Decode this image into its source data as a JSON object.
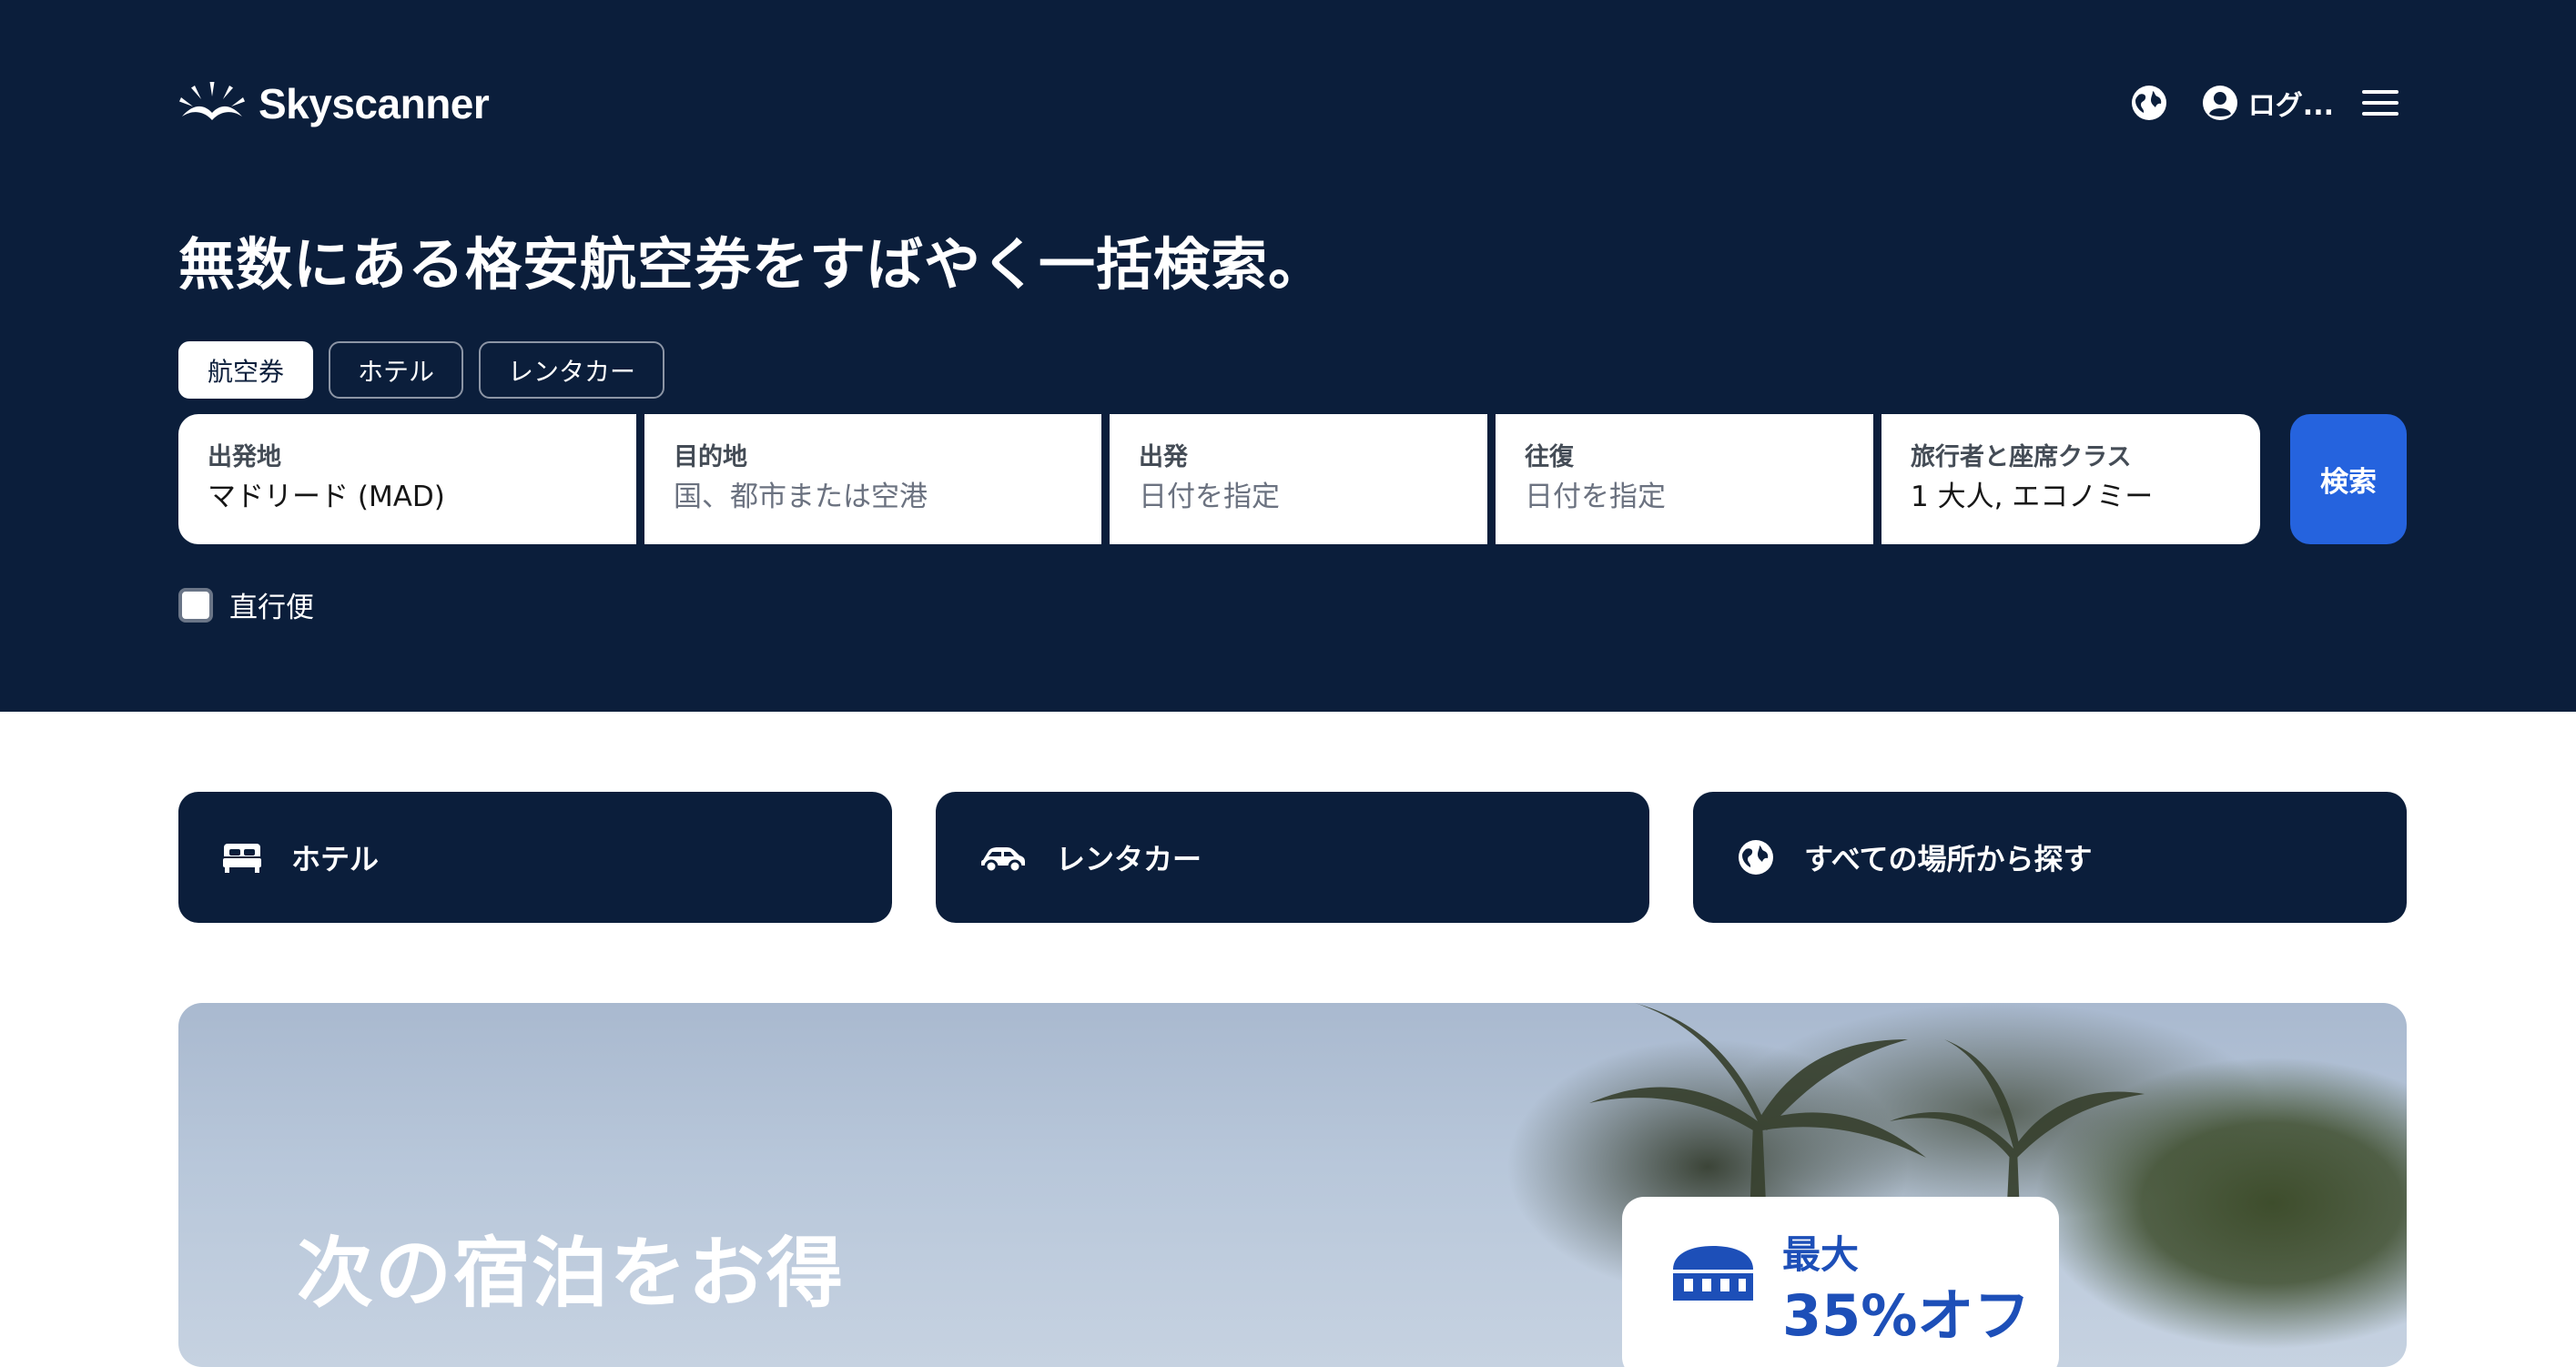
{
  "brand": {
    "name": "Skyscanner"
  },
  "header": {
    "login_label": "ログ..."
  },
  "hero": {
    "headline": "無数にある格安航空券をすばやく一括検索。",
    "tabs": [
      {
        "label": "航空券",
        "active": true
      },
      {
        "label": "ホテル",
        "active": false
      },
      {
        "label": "レンタカー",
        "active": false
      }
    ],
    "fields": {
      "origin": {
        "label": "出発地",
        "value": "マドリード (MAD)"
      },
      "destination": {
        "label": "目的地",
        "placeholder": "国、都市または空港"
      },
      "depart": {
        "label": "出発",
        "placeholder": "日付を指定"
      },
      "return": {
        "label": "往復",
        "placeholder": "日付を指定"
      },
      "travellers": {
        "label": "旅行者と座席クラス",
        "value": "1 大人, エコノミー"
      }
    },
    "search_label": "検索",
    "direct_label": "直行便",
    "direct_checked": false
  },
  "quick_links": [
    {
      "label": "ホテル",
      "icon": "bed-icon"
    },
    {
      "label": "レンタカー",
      "icon": "car-icon"
    },
    {
      "label": "すべての場所から探す",
      "icon": "globe-icon"
    }
  ],
  "promo": {
    "title": "次の宿泊をお得",
    "badge_top": "最大",
    "badge_big": "35%オフ"
  },
  "colors": {
    "hero_bg": "#0b1e3b",
    "accent": "#2563de",
    "white": "#ffffff"
  }
}
